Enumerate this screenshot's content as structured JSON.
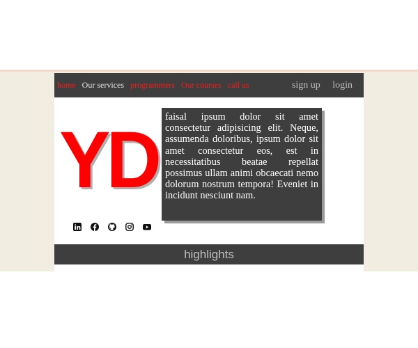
{
  "nav": {
    "left_links": [
      {
        "label": "home",
        "color": "#ff1a1a"
      },
      {
        "label": "Our services",
        "color": "#e6e6e6"
      },
      {
        "label": "programmers",
        "color": "#ff1a1a"
      },
      {
        "label": "Our courses",
        "color": "#ff1a1a"
      },
      {
        "label": "call us",
        "color": "#ff1a1a"
      }
    ],
    "sign_up": "sign up",
    "login": "login"
  },
  "logo": {
    "text": "YD",
    "color": "#ff0000"
  },
  "about": {
    "text": "faisal ipsum dolor sit amet consectetur adipisicing elit. Neque, assumenda doloribus, ipsum dolor sit amet consectetur eos, est in necessitatibus beatae repellat possimus ullam animi obcaecati nemo dolorum nostrum tempora! Eveniet in incidunt nesciunt nam."
  },
  "socials": [
    {
      "icon": "linkedin-icon"
    },
    {
      "icon": "facebook-icon"
    },
    {
      "icon": "github-icon"
    },
    {
      "icon": "instagram-icon"
    },
    {
      "icon": "youtube-icon"
    }
  ],
  "highlights": {
    "label": "highlights"
  },
  "colors": {
    "nav_bg": "#3d3e3d",
    "page_bg": "#f1ede0",
    "accent": "#ff0000"
  }
}
